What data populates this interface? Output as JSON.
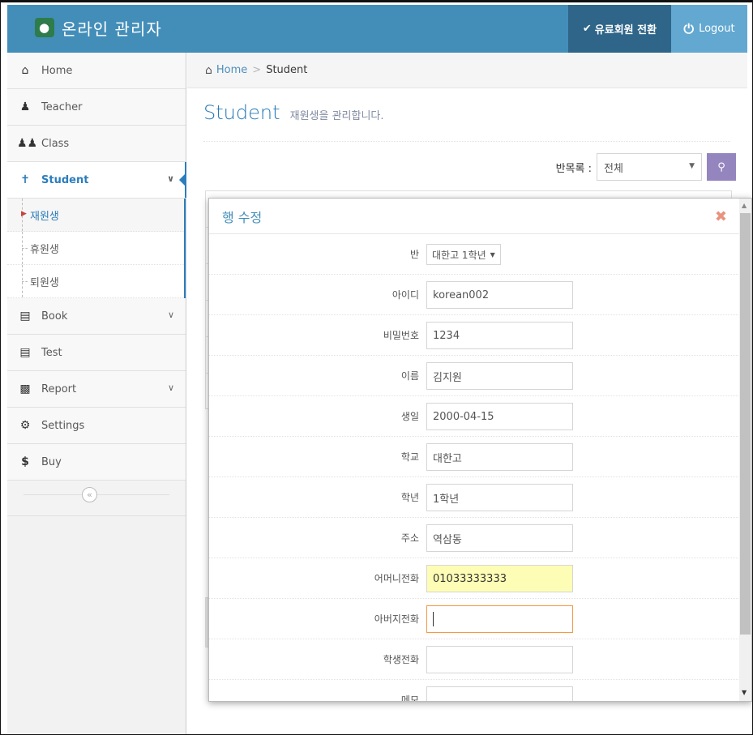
{
  "navbar": {
    "brand_title": "온라인 관리자",
    "upgrade_label": "유료회원 전환",
    "logout_label": "Logout"
  },
  "sidebar": {
    "items": [
      {
        "label": "Home",
        "icon": "home-icon"
      },
      {
        "label": "Teacher",
        "icon": "user-icon"
      },
      {
        "label": "Class",
        "icon": "users-icon"
      },
      {
        "label": "Student",
        "icon": "child-icon"
      },
      {
        "label": "Book",
        "icon": "book-icon"
      },
      {
        "label": "Test",
        "icon": "list-icon"
      },
      {
        "label": "Report",
        "icon": "bar-chart-icon"
      },
      {
        "label": "Settings",
        "icon": "cog-icon"
      },
      {
        "label": "Buy",
        "icon": "dollar-icon"
      }
    ],
    "student_sub": [
      "재원생",
      "휴원생",
      "퇴원생"
    ]
  },
  "breadcrumb": {
    "home": "Home",
    "current": "Student"
  },
  "page": {
    "title": "Student",
    "subtitle": "재원생을 관리합니다.",
    "filter_label": "반목록 :",
    "filter_value": "전체"
  },
  "modal": {
    "title": "행 수정",
    "fields": [
      {
        "label": "반",
        "value": "대한고 1학년"
      },
      {
        "label": "아이디",
        "value": "korean002"
      },
      {
        "label": "비밀번호",
        "value": "1234"
      },
      {
        "label": "이름",
        "value": "김지원"
      },
      {
        "label": "생일",
        "value": "2000-04-15"
      },
      {
        "label": "학교",
        "value": "대한고"
      },
      {
        "label": "학년",
        "value": "1학년"
      },
      {
        "label": "주소",
        "value": "역삼동"
      },
      {
        "label": "어머니전화",
        "value": "01033333333"
      },
      {
        "label": "아버지전화",
        "value": ""
      },
      {
        "label": "학생전화",
        "value": ""
      },
      {
        "label": "메모",
        "value": ""
      }
    ]
  },
  "colors": {
    "navbar": "#438eb9",
    "accent": "#2b7dbc",
    "search_button": "#9585bf",
    "highlight_input": "#fdfdb6",
    "focus_border": "#f59942"
  }
}
